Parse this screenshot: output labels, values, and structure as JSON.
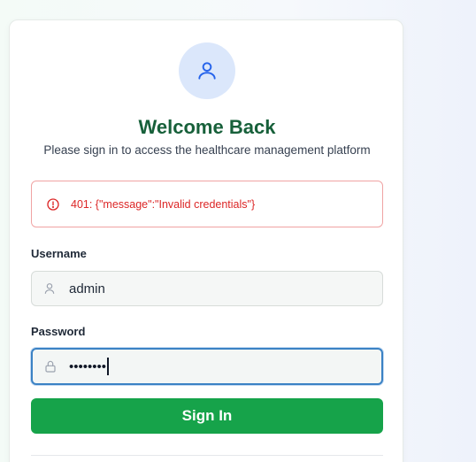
{
  "header": {
    "title": "Welcome Back",
    "subtitle": "Please sign in to access the healthcare management platform"
  },
  "error": {
    "message": "401: {\"message\":\"Invalid credentials\"}",
    "icon": "alert-circle-icon",
    "color": "#dc2626"
  },
  "form": {
    "username": {
      "label": "Username",
      "value": "admin",
      "icon": "user-icon"
    },
    "password": {
      "label": "Password",
      "masked_value": "••••••••",
      "icon": "lock-icon"
    },
    "submit_label": "Sign In"
  },
  "colors": {
    "brand_green": "#16a34a",
    "title_green": "#17603a",
    "avatar_bg": "#dbe7fb",
    "focus_blue": "#3b82c4"
  }
}
